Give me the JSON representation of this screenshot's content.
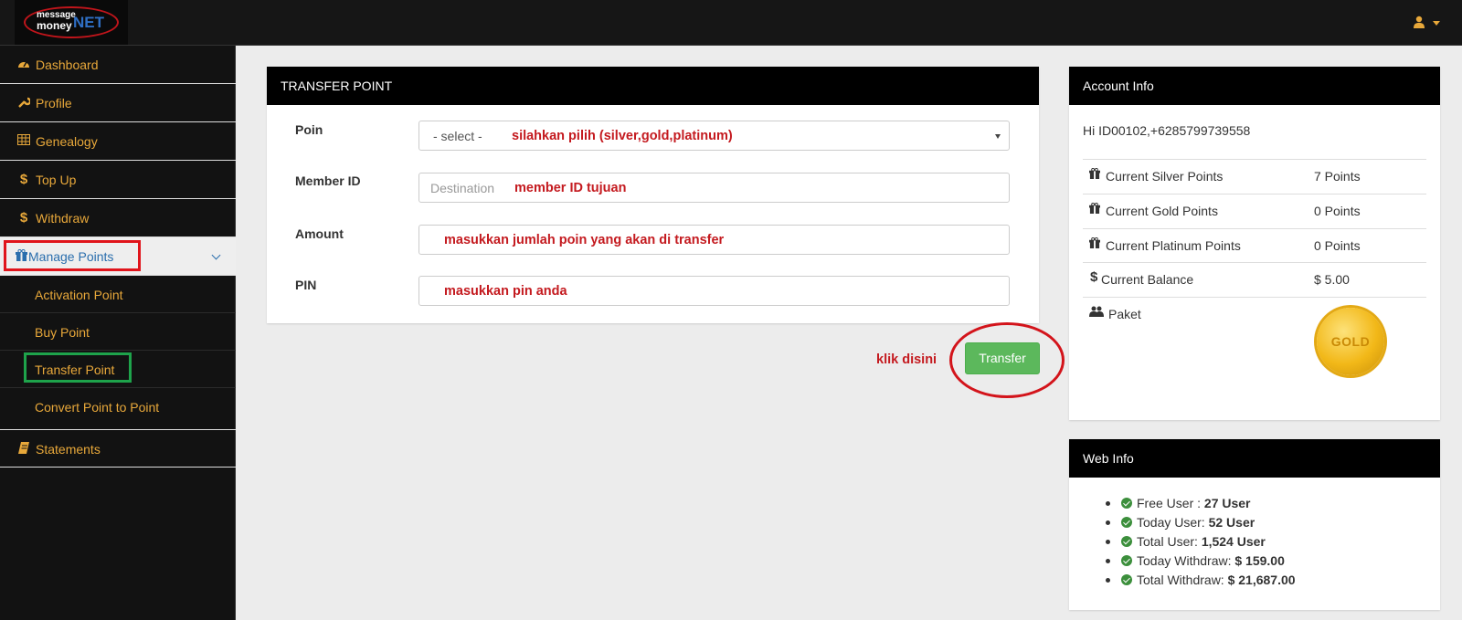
{
  "brand": {
    "logo_line1": "message",
    "logo_line2": "money",
    "logo_line3": "NET"
  },
  "colors": {
    "accent": "#e8a83a",
    "header_bg": "#161616",
    "sidebar_bg": "#121212",
    "success": "#5cb85c",
    "annotation": "#c41a1f"
  },
  "header": {
    "user_icon": "user-icon"
  },
  "sidebar": {
    "items": [
      {
        "label": "Dashboard",
        "icon": "dashboard-icon"
      },
      {
        "label": "Profile",
        "icon": "wrench-icon"
      },
      {
        "label": "Genealogy",
        "icon": "table-icon"
      },
      {
        "label": "Top Up",
        "icon": "dollar-icon"
      },
      {
        "label": "Withdraw",
        "icon": "dollar-icon"
      },
      {
        "label": "Manage Points",
        "icon": "gift-icon"
      },
      {
        "label": "Statements",
        "icon": "book-icon"
      }
    ],
    "sub_items": [
      {
        "label": "Activation Point"
      },
      {
        "label": "Buy Point"
      },
      {
        "label": "Transfer Point"
      },
      {
        "label": "Convert Point to Point"
      }
    ]
  },
  "transfer": {
    "title": "TRANSFER POINT",
    "fields": {
      "poin": {
        "label": "Poin",
        "value": "- select -",
        "annotation": "silahkan pilih (silver,gold,platinum)"
      },
      "member": {
        "label": "Member ID",
        "placeholder": "Destination",
        "annotation": "member ID tujuan"
      },
      "amount": {
        "label": "Amount",
        "annotation": "masukkan jumlah poin yang akan di transfer"
      },
      "pin": {
        "label": "PIN",
        "annotation": "masukkan pin anda"
      }
    },
    "click_hint": "klik disini",
    "submit_label": "Transfer"
  },
  "account": {
    "title": "Account Info",
    "greeting": "Hi ID00102,+6285799739558",
    "rows": [
      {
        "label": "Current Silver Points",
        "value": "7 Points",
        "icon": "gift-icon"
      },
      {
        "label": "Current Gold Points",
        "value": "0 Points",
        "icon": "gift-icon"
      },
      {
        "label": "Current Platinum Points",
        "value": "0 Points",
        "icon": "gift-icon"
      },
      {
        "label": "Current Balance",
        "value": "$ 5.00",
        "icon": "dollar-icon"
      },
      {
        "label": "Paket",
        "icon": "users-icon"
      }
    ],
    "badge": "GOLD"
  },
  "web": {
    "title": "Web Info",
    "items": [
      {
        "label": "Free User : ",
        "value": "27 User"
      },
      {
        "label": "Today User: ",
        "value": "52 User"
      },
      {
        "label": "Total User: ",
        "value": "1,524 User"
      },
      {
        "label": "Today Withdraw: ",
        "value": "$ 159.00"
      },
      {
        "label": "Total Withdraw: ",
        "value": "$ 21,687.00"
      }
    ]
  }
}
